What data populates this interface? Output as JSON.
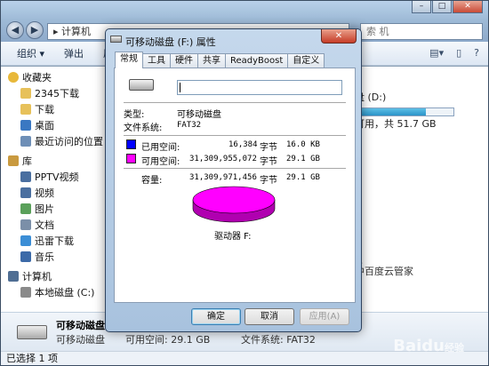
{
  "explorer": {
    "address": "计算机",
    "search_placeholder": "索 机",
    "toolbar": [
      "组织 ▾",
      "弹出",
      "属性"
    ],
    "sidebar": [
      {
        "label": "收藏夹",
        "group": true,
        "icon": "star-icon"
      },
      {
        "label": "2345下载",
        "icon": "folder-icon"
      },
      {
        "label": "下载",
        "icon": "folder-icon"
      },
      {
        "label": "桌面",
        "icon": "desktop-icon"
      },
      {
        "label": "最近访问的位置",
        "icon": "recent-icon"
      },
      {
        "label": "库",
        "group": true,
        "icon": "library-icon"
      },
      {
        "label": "PPTV视频",
        "icon": "video-icon"
      },
      {
        "label": "视频",
        "icon": "video-icon"
      },
      {
        "label": "图片",
        "icon": "image-icon"
      },
      {
        "label": "文档",
        "icon": "document-icon"
      },
      {
        "label": "迅雷下载",
        "icon": "download-icon"
      },
      {
        "label": "音乐",
        "icon": "music-icon"
      },
      {
        "label": "计算机",
        "group": true,
        "icon": "computer-icon"
      },
      {
        "label": "本地磁盘 (C:)",
        "icon": "drive-icon"
      }
    ],
    "drive_d": {
      "name": "盘 (D:)",
      "free": "可用，共 51.7 GB",
      "used_fraction": 0.72
    },
    "side_text": [
      "▲",
      "中百度云管家"
    ],
    "details": {
      "name": "可移动磁盘 (F:)",
      "type": "可移动磁盘",
      "available": "可用空间: 29.1 GB",
      "fs": "文件系统: FAT32"
    },
    "status": "已选择 1 项"
  },
  "dialog": {
    "title": "可移动磁盘 (F:) 属性",
    "close": "✕",
    "tabs": [
      "常规",
      "工具",
      "硬件",
      "共享",
      "ReadyBoost",
      "自定义"
    ],
    "name_value": "",
    "type_label": "类型:",
    "type_value": "可移动磁盘",
    "fs_label": "文件系统:",
    "fs_value": "FAT32",
    "used_label": "已用空间:",
    "used_bytes": "16,384",
    "used_unit": "字节",
    "used_size": "16.0 KB",
    "free_label": "可用空间:",
    "free_bytes": "31,309,955,072",
    "free_unit": "字节",
    "free_size": "29.1 GB",
    "cap_label": "容量:",
    "cap_bytes": "31,309,971,456",
    "cap_unit": "字节",
    "cap_size": "29.1 GB",
    "drive_label": "驱动器 F:",
    "used_color": "#0000ff",
    "free_color": "#ff00ff",
    "ok": "确定",
    "cancel": "取消",
    "apply": "应用(A)"
  },
  "watermark": {
    "text": "Baidu",
    "sub": "经验"
  }
}
